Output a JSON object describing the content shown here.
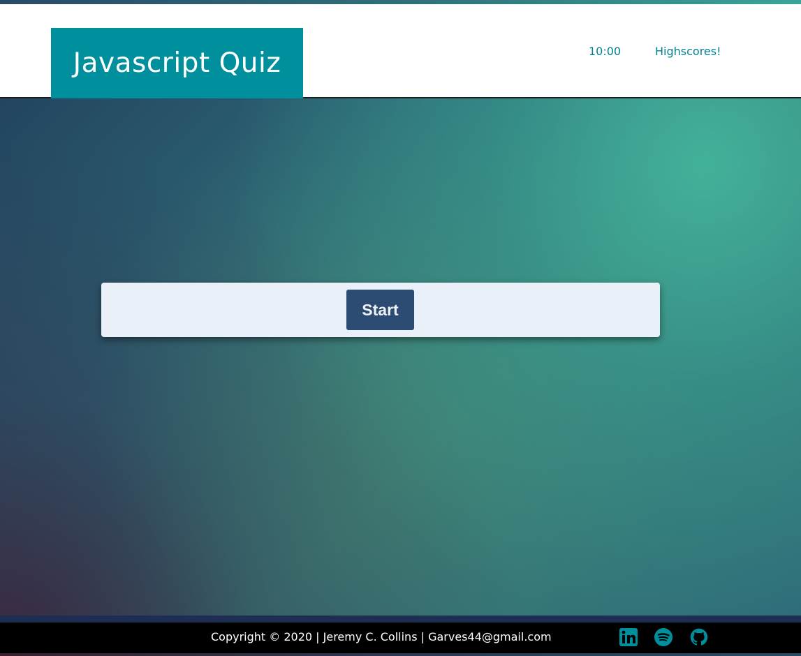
{
  "header": {
    "title": "Javascript Quiz",
    "timer": "10:00",
    "highscores_label": "Highscores!"
  },
  "main": {
    "start_label": "Start"
  },
  "footer": {
    "copyright": "Copyright © 2020 | Jeremy C. Collins | Garves44@gmail.com",
    "social": [
      {
        "icon": "linkedin-icon"
      },
      {
        "icon": "spotify-icon"
      },
      {
        "icon": "github-icon"
      }
    ]
  },
  "colors": {
    "brand": "#008f9d",
    "accent_text": "#00808e",
    "button": "#2b4b72",
    "card": "#eaf0f8",
    "social_icon": "#008f9d"
  }
}
